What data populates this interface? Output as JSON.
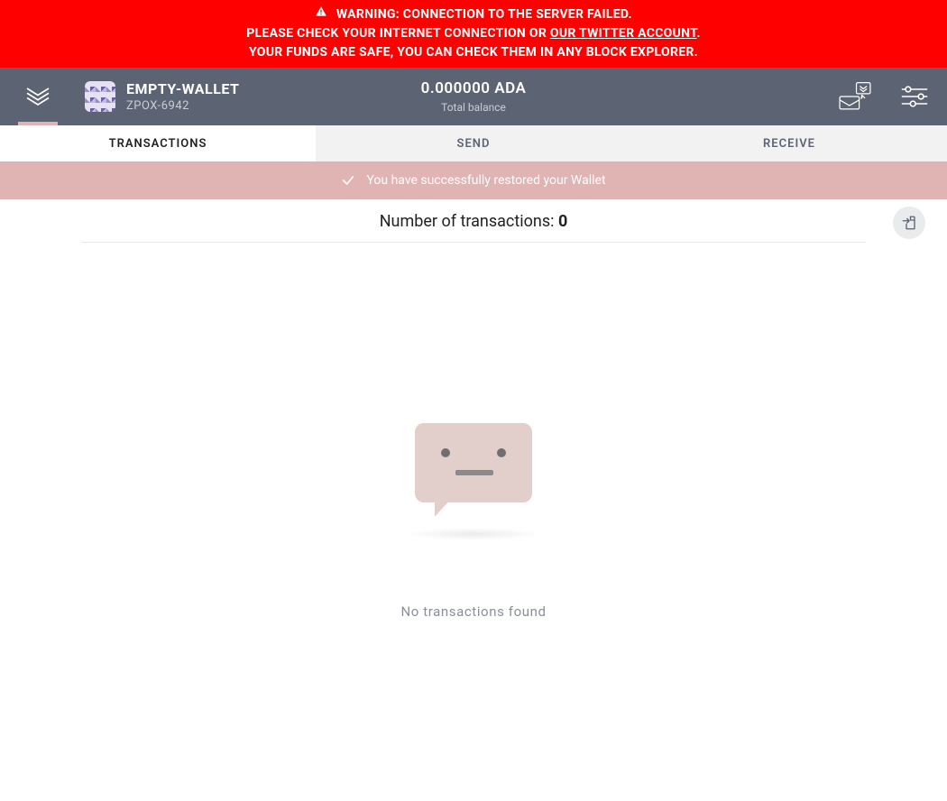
{
  "warning": {
    "line1_prefix": "WARNING: CONNECTION TO THE SERVER FAILED.",
    "line2_prefix": "PLEASE CHECK YOUR INTERNET CONNECTION OR ",
    "line2_link": "OUR TWITTER ACCOUNT",
    "line2_suffix": ".",
    "line3": "YOUR FUNDS ARE SAFE, YOU CAN CHECK THEM IN ANY BLOCK EXPLORER."
  },
  "wallet": {
    "name": "EMPTY-WALLET",
    "plate": "ZPOX-6942"
  },
  "balance": {
    "amount": "0.000000 ADA",
    "label": "Total balance"
  },
  "tabs": {
    "transactions": "TRANSACTIONS",
    "send": "SEND",
    "receive": "RECEIVE"
  },
  "notice": {
    "message": "You have successfully restored your Wallet"
  },
  "transactions": {
    "count_label": "Number of transactions: ",
    "count_value": "0",
    "empty_message": "No transactions found"
  },
  "icons": {
    "app_logo": "yoroi-logo-icon",
    "delegation": "delegation-icon",
    "settings_sliders": "settings-icon",
    "checkmark": "check-icon",
    "export": "export-file-icon",
    "warning_triangle": "warning-triangle-icon",
    "wallet_identicon": "wallet-identicon"
  },
  "colors": {
    "banner_red": "#FF0000",
    "topbar": "#5C6372",
    "accent_pink": "#DFB4B2",
    "bubble": "#E2CFCB"
  }
}
